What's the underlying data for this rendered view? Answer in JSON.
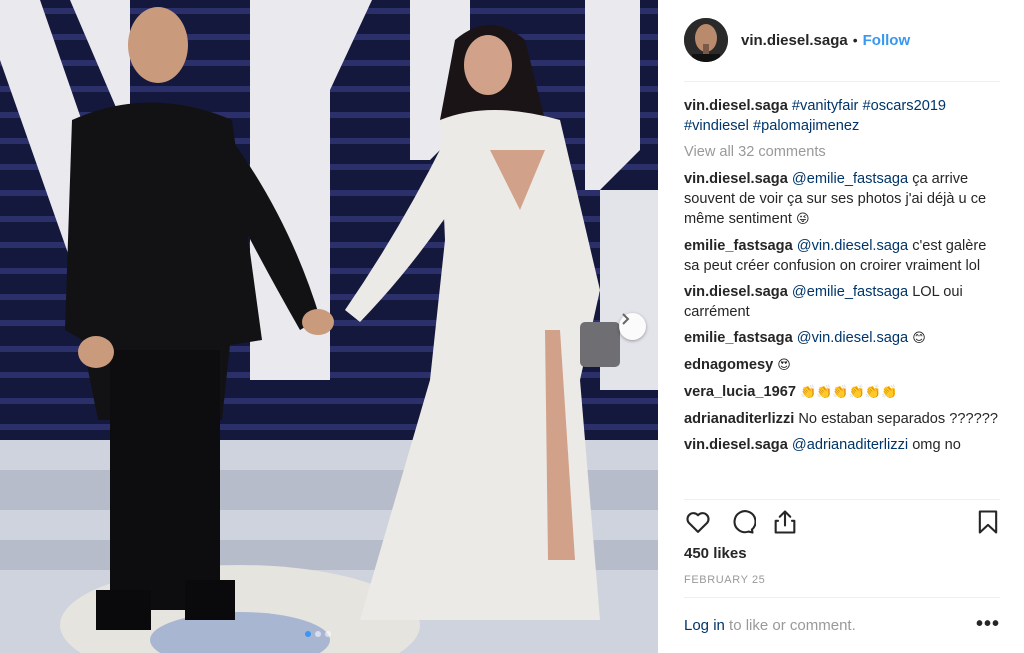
{
  "post": {
    "username": "vin.diesel.saga",
    "separator": "•",
    "follow_label": "Follow"
  },
  "comments": {
    "view_all": "View all 32 comments",
    "caption": {
      "user": "vin.diesel.saga",
      "tags": [
        "#vanityfair",
        "#oscars2019",
        "#vindiesel",
        "#palomajimenez"
      ]
    },
    "items": [
      {
        "user": "vin.diesel.saga",
        "mention": "@emilie_fastsaga",
        "text": "ça arrive souvent de voir ça sur ses photos j'ai déjà u ce même sentiment",
        "emoji": "😜"
      },
      {
        "user": "emilie_fastsaga",
        "mention": "@vin.diesel.saga",
        "text": "c'est galère sa peut créer confusion on croirer vraiment lol",
        "emoji": ""
      },
      {
        "user": "vin.diesel.saga",
        "mention": "@emilie_fastsaga",
        "text": "LOL oui carrément",
        "emoji": ""
      },
      {
        "user": "emilie_fastsaga",
        "mention": "@vin.diesel.saga",
        "text": "",
        "emoji": "😊"
      },
      {
        "user": "ednagomesy",
        "mention": "",
        "text": "",
        "emoji": "😍"
      },
      {
        "user": "vera_lucia_1967",
        "mention": "",
        "text": "",
        "emoji": "👏👏👏👏👏👏"
      },
      {
        "user": "adrianaditerlizzi",
        "mention": "",
        "text": "No estaban separados ??????",
        "emoji": ""
      },
      {
        "user": "vin.diesel.saga",
        "mention": "@adrianaditerlizzi",
        "text": "omg no",
        "emoji": ""
      }
    ]
  },
  "actions": {
    "icons": [
      "heart-icon",
      "comment-icon",
      "share-icon",
      "bookmark-icon"
    ]
  },
  "likes": "450 likes",
  "date": "FEBRUARY 25",
  "login": {
    "link": "Log in",
    "text": "to like or comment.",
    "more": "•••"
  },
  "carousel": {
    "slides": 3,
    "active_slide": 1
  },
  "colors": {
    "link_blue": "#3897f0",
    "tag_navy": "#003569",
    "muted_gray": "#999999",
    "text_dark": "#262626"
  }
}
